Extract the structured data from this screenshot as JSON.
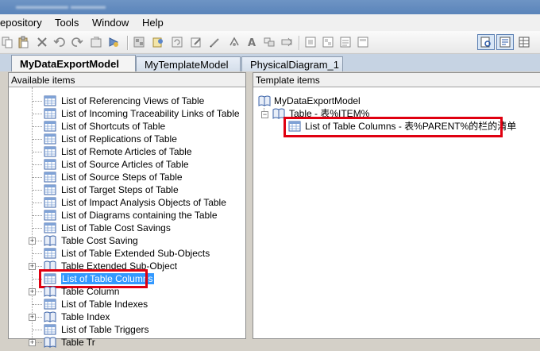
{
  "menu": {
    "repository": "epository",
    "tools": "Tools",
    "window": "Window",
    "help": "Help"
  },
  "toolbar": {
    "buttons": [
      "copy-icon",
      "paste-icon",
      "delete-icon",
      "undo-icon",
      "redo-icon",
      "properties-icon",
      "check-model-icon",
      "model-icon",
      "browse-icon",
      "refresh-icon",
      "edit-icon",
      "pencil-icon",
      "connect-icon",
      "text-icon",
      "arrange-icon",
      "toggle-icon",
      "view-1-icon",
      "view-2-icon",
      "view-3-icon",
      "view-4-icon",
      "preview-icon",
      "outline-icon",
      "table-view-icon"
    ]
  },
  "tabs": [
    {
      "label": "MyDataExportModel",
      "active": true
    },
    {
      "label": "MyTemplateModel",
      "active": false
    },
    {
      "label": "PhysicalDiagram_1",
      "active": false
    }
  ],
  "left_pane": {
    "header": "Available items",
    "items": [
      {
        "label": "List of Referencing Views of Table",
        "kind": "list"
      },
      {
        "label": "List of Incoming Traceability Links of Table",
        "kind": "list"
      },
      {
        "label": "List of Shortcuts of Table",
        "kind": "list"
      },
      {
        "label": "List of Replications of Table",
        "kind": "list"
      },
      {
        "label": "List of Remote Articles of Table",
        "kind": "list"
      },
      {
        "label": "List of Source Articles of Table",
        "kind": "list"
      },
      {
        "label": "List of Source Steps of Table",
        "kind": "list"
      },
      {
        "label": "List of Target Steps of Table",
        "kind": "list"
      },
      {
        "label": "List of Impact Analysis Objects of Table",
        "kind": "list"
      },
      {
        "label": "List of Diagrams containing the Table",
        "kind": "list"
      },
      {
        "label": "List of Table Cost Savings",
        "kind": "list"
      },
      {
        "label": "Table Cost Saving",
        "kind": "book"
      },
      {
        "label": "List of Table Extended Sub-Objects",
        "kind": "list"
      },
      {
        "label": "Table Extended Sub-Object",
        "kind": "book"
      },
      {
        "label": "List of Table Columns",
        "kind": "list",
        "selected": true
      },
      {
        "label": "Table Column",
        "kind": "book"
      },
      {
        "label": "List of Table Indexes",
        "kind": "list"
      },
      {
        "label": "Table Index",
        "kind": "book"
      },
      {
        "label": "List of Table Triggers",
        "kind": "list"
      },
      {
        "label": "Table Tr",
        "kind": "book"
      }
    ]
  },
  "right_pane": {
    "header": "Template items",
    "root": "MyDataExportModel",
    "child": "Table - 表%ITEM%",
    "grandchild": "List of Table Columns - 表%PARENT%的栏的清单"
  },
  "colors": {
    "highlight": "#e00010",
    "selection": "#3399ff",
    "tab_strip": "#c6d3e3"
  }
}
